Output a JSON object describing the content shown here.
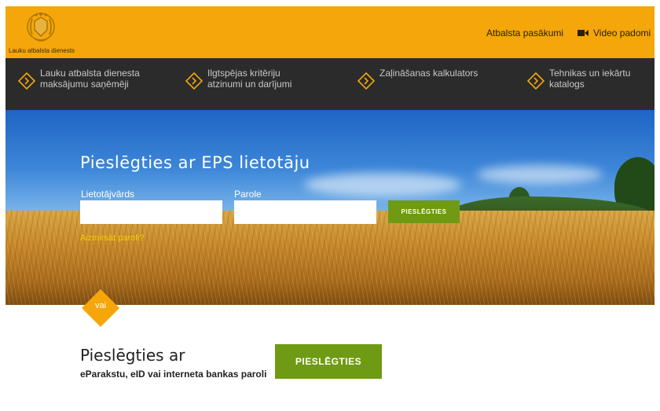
{
  "header": {
    "logo_text": "Lauku atbalsta dienests",
    "links": [
      {
        "label": "Atbalsta pasākumi"
      },
      {
        "label": "Video padomi"
      }
    ]
  },
  "nav": {
    "items": [
      {
        "line1": "Lauku atbalsta dienesta",
        "line2": "maksājumu saņēmēji"
      },
      {
        "line1": "Ilgtspējas kritēriju",
        "line2": "atzinumi un darījumi"
      },
      {
        "line1": "Zaļināšanas kalkulators",
        "line2": ""
      },
      {
        "line1": "Tehnikas un iekārtu",
        "line2": "katalogs"
      }
    ]
  },
  "login": {
    "title": "Pieslēgties ar EPS lietotāju",
    "username_label": "Lietotājvārds",
    "username_value": "",
    "password_label": "Parole",
    "password_value": "",
    "submit_label": "PIESLĒGTIES",
    "forgot_label": "Aizmirsāt paroli?"
  },
  "separator": {
    "label": "vai"
  },
  "alt_login": {
    "title": "Pieslēgties ar",
    "subtitle": "eParakstu, eID vai interneta bankas paroli",
    "button_label": "PIESLĒGTIES"
  },
  "colors": {
    "brand_orange": "#f5a60a",
    "nav_dark": "#2b2b2b",
    "accent_green": "#6f9a13",
    "link_yellow": "#f0d000"
  }
}
